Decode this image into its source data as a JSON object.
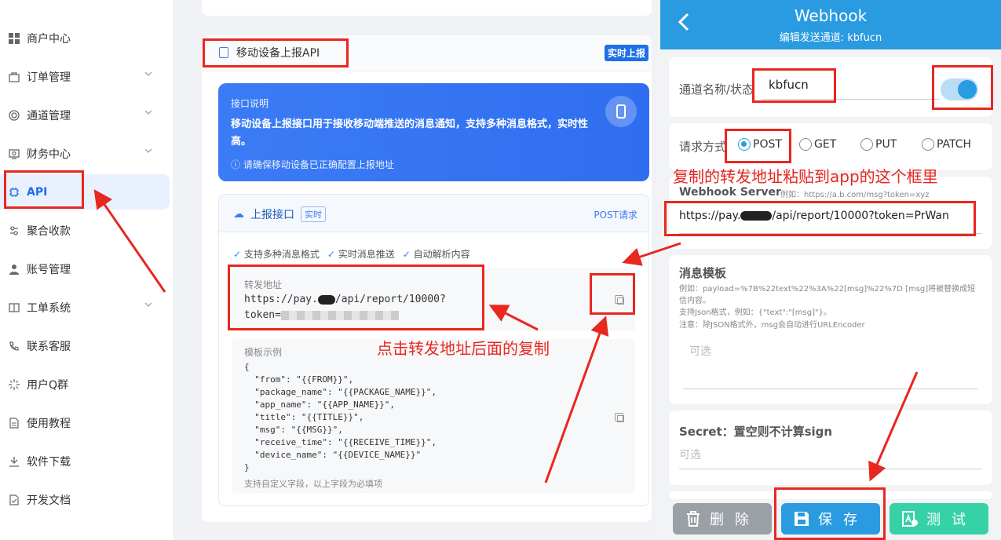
{
  "sidebar": {
    "items": [
      {
        "label": "商户中心",
        "icon": "grid-icon"
      },
      {
        "label": "订单管理",
        "icon": "bag-icon",
        "expandable": true
      },
      {
        "label": "通道管理",
        "icon": "channel-icon",
        "expandable": true
      },
      {
        "label": "财务中心",
        "icon": "finance-icon",
        "expandable": true
      },
      {
        "label": "API",
        "icon": "chip-icon",
        "active": true
      },
      {
        "label": "聚合收款",
        "icon": "aggregate-icon"
      },
      {
        "label": "账号管理",
        "icon": "user-icon"
      },
      {
        "label": "工单系统",
        "icon": "book-icon",
        "expandable": true
      },
      {
        "label": "联系客服",
        "icon": "phone-icon"
      },
      {
        "label": "用户Q群",
        "icon": "sparkle-icon"
      },
      {
        "label": "使用教程",
        "icon": "doc-icon"
      },
      {
        "label": "软件下载",
        "icon": "download-icon"
      },
      {
        "label": "开发文档",
        "icon": "file-check-icon"
      }
    ]
  },
  "main": {
    "section_title": "移动设备上报API",
    "realtime_badge": "实时上报",
    "info": {
      "title": "接口说明",
      "desc": "移动设备上报接口用于接收移动端推送的消息通知，支持多种消息格式，实时性高。",
      "note": "ⓘ 请确保移动设备已正确配置上报地址"
    },
    "report": {
      "title": "上报接口",
      "tag": "实时",
      "method": "POST请求",
      "features": [
        "支持多种消息格式",
        "实时消息推送",
        "自动解析内容"
      ],
      "forward_label": "转发地址",
      "forward_url_start": "https://pay.",
      "forward_url_mid": "/api/report/10000?",
      "forward_url_end": "token=",
      "template_label": "模板示例",
      "template_code": "{\n  \"from\": \"{{FROM}}\",\n  \"package_name\": \"{{PACKAGE_NAME}}\",\n  \"app_name\": \"{{APP_NAME}}\",\n  \"title\": \"{{TITLE}}\",\n  \"msg\": \"{{MSG}}\",\n  \"receive_time\": \"{{RECEIVE_TIME}}\",\n  \"device_name\": \"{{DEVICE_NAME}}\"\n}",
      "template_footer": "支持自定义字段，以上字段为必填项"
    }
  },
  "webhook": {
    "title": "Webhook",
    "subtitle": "编辑发送通道: kbfucn",
    "name_label": "通道名称/状态",
    "name_value": "kbfucn",
    "status_on": true,
    "method_label": "请求方式",
    "methods": [
      "POST",
      "GET",
      "PUT",
      "PATCH"
    ],
    "selected_method": "POST",
    "server_label": "Webhook Server",
    "server_example": "例如：https://a.b.com/msg?token=xyz",
    "server_value_start": "https://pay.",
    "server_value_end": "/api/report/10000?token=PrWan",
    "template_label": "消息模板",
    "template_help1": "例如：payload=%7B%22text%22%3A%22[msg]%22%7D [msg]将被替换成短信内容。",
    "template_help2": "支持Json格式，例如：{\"text\":\"[msg]\"}。",
    "template_help3": "注意：除JSON格式外，msg会自动进行URLEncoder",
    "template_placeholder": "可选",
    "secret_label": "Secret：置空则不计算sign",
    "secret_placeholder": "可选",
    "buttons": {
      "delete": "删除",
      "save": "保存",
      "test": "测试"
    }
  },
  "annotations": {
    "top_right": "复制的转发地址粘贴到app的这个框里",
    "middle": "点击转发地址后面的复制"
  },
  "colors": {
    "accent": "#1e6fe8",
    "header": "#2a9be0",
    "annotation": "#e8271f"
  }
}
